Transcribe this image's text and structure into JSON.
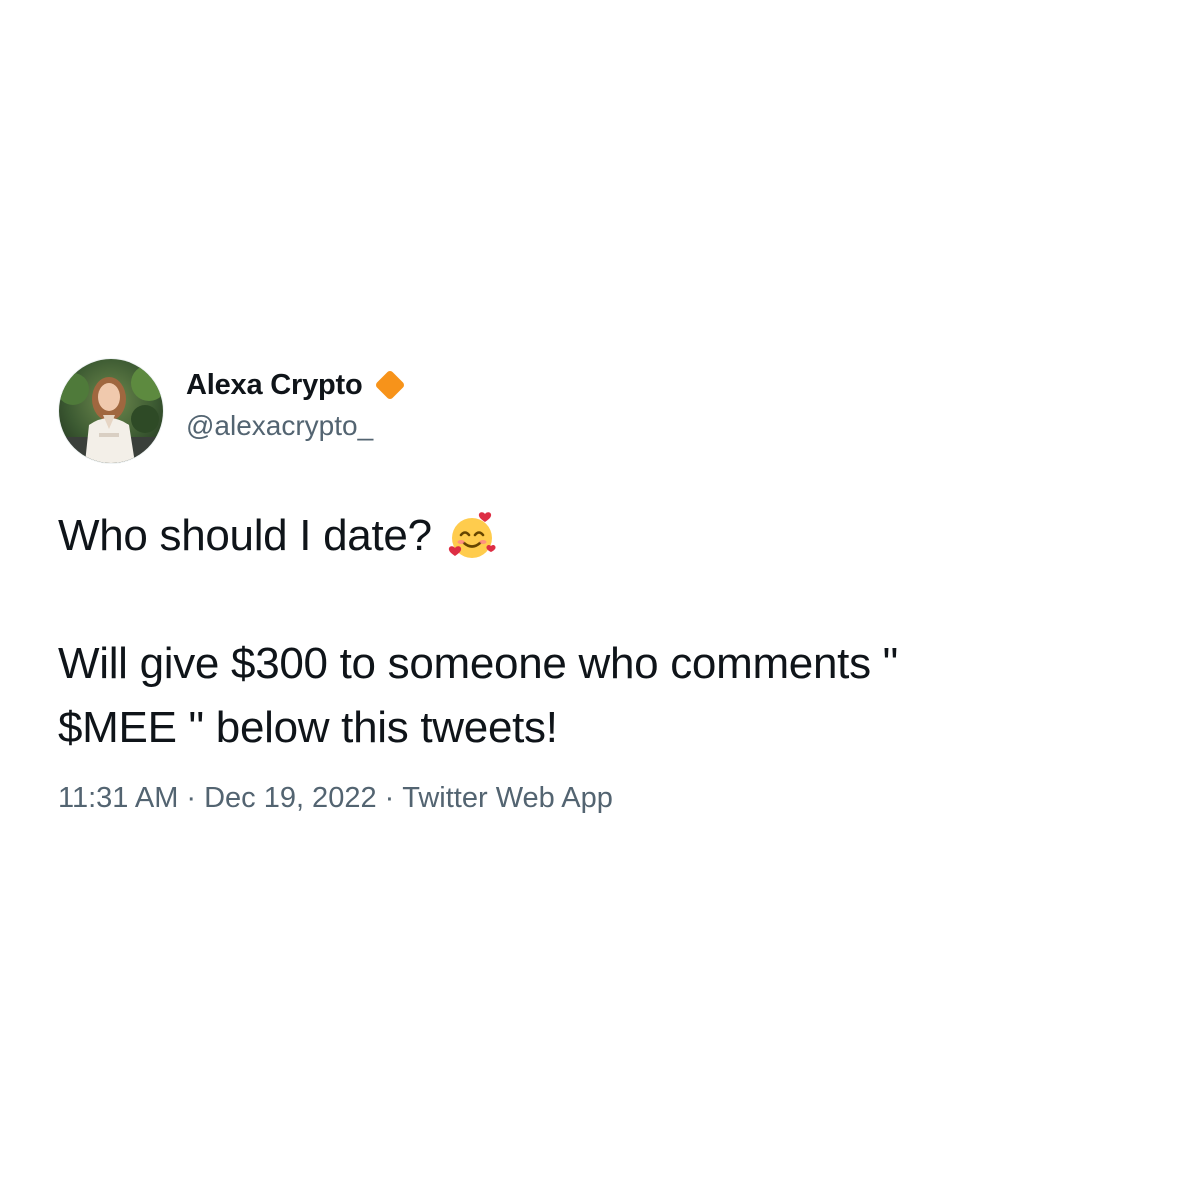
{
  "author": {
    "display_name": "Alexa Crypto",
    "handle": "@alexacrypto_",
    "avatar": "profile-photo",
    "badge_icon": "verified-diamond-icon",
    "badge_color": "#f7931a"
  },
  "tweet": {
    "line1": "Who should I date?",
    "emoji_icon": "smiling-face-with-hearts-icon",
    "line2": "Will give $300 to someone who comments \"",
    "line3": "$MEE \" below this tweets!"
  },
  "meta": {
    "time": "11:31 AM",
    "separator": "·",
    "date": "Dec 19, 2022",
    "source": "Twitter Web App"
  }
}
